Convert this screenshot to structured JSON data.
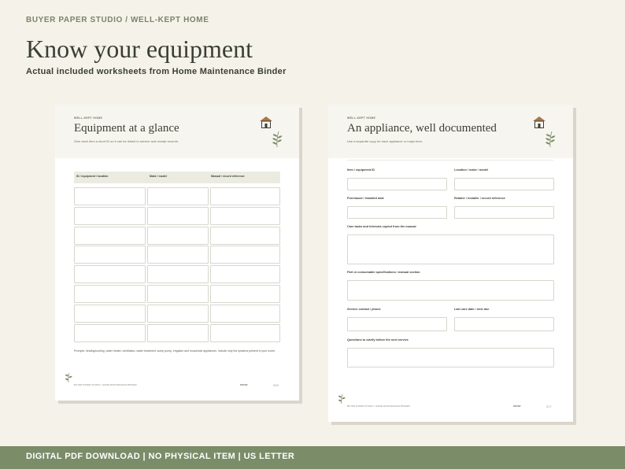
{
  "header": {
    "brand": "BUYER PAPER STUDIO  /  WELL-KEPT HOME",
    "title": "Know your equipment",
    "subtitle": "Actual included worksheets from Home Maintenance Binder"
  },
  "sheet1": {
    "kicker": "WELL-KEPT HOME",
    "title": "Equipment at a glance",
    "description": "Give each item a short ID so it can be linked to service and receipt records.",
    "columns": [
      "ID / equipment / location",
      "Make / model",
      "Manual / record reference"
    ],
    "row_count": 8,
    "prompt": "Prompts: heating/cooling, water heater, ventilation, water treatment, sump pump, irrigation and household appliances. Include only the systems present in your home.",
    "footer_left": "BUYER PAPER STUDIO  /  HOME MAINTENANCE BINDER",
    "footer_mid": "KNOW",
    "page": "005"
  },
  "sheet2": {
    "kicker": "WELL-KEPT HOME",
    "title": "An appliance, well documented",
    "description": "Use a separate copy for each appliance or major item.",
    "fields": {
      "item_id": "Item / equipment ID",
      "location": "Location / make / model",
      "purchased": "Purchased / installed date",
      "retailer": "Retailer / installer / record reference",
      "care": "Care tasks and intervals copied from the manual",
      "parts": "Part or consumable specifications / manual section",
      "service": "Service contact / phone",
      "last_care": "Last care date / next due",
      "questions": "Questions to clarify before the next service"
    },
    "footer_left": "BUYER PAPER STUDIO  /  HOME MAINTENANCE BINDER",
    "footer_mid": "KNOW",
    "page": "017"
  },
  "footer": {
    "text": "DIGITAL PDF DOWNLOAD  |  NO PHYSICAL ITEM  |  US LETTER"
  },
  "colors": {
    "background": "#f5f2ea",
    "accent_green": "#7b8c68",
    "text_dark": "#3a3f33",
    "house_brown": "#a8774a"
  },
  "icons": [
    "house-icon",
    "sprig-icon"
  ]
}
